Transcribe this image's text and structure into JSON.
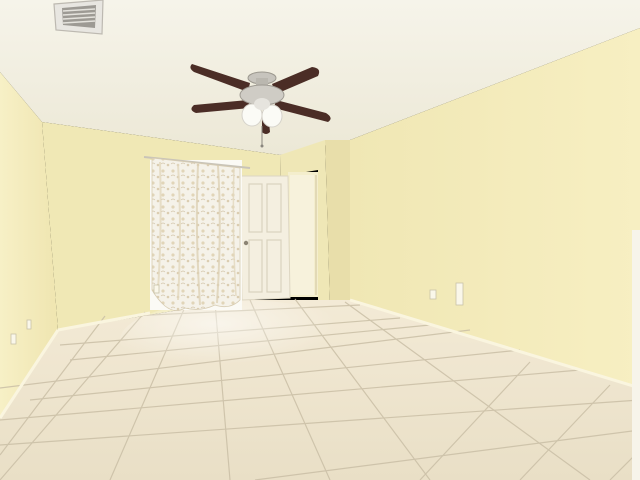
{
  "scene": {
    "kind": "empty-room-interior",
    "colors": {
      "ceiling": "#f3f0e2",
      "back_wall": "#f1eab8",
      "left_wall": "#f4ebb8",
      "right_wall": "#f6eebd",
      "floor_tile": "#efe6cf",
      "grout": "#c9bea6",
      "baseboard": "#f8f3dc",
      "door": "#f4efe0",
      "curtain": "#f3f0e6",
      "fan_blade": "#4a2d25",
      "fan_metal": "#b9b6b0",
      "vent": "#e9e7e2"
    },
    "objects": [
      "ceiling-fan-icon",
      "air-vent-icon",
      "curtain-icon",
      "door-icon",
      "doorway-icon",
      "outlet-icon",
      "tile-floor"
    ]
  }
}
